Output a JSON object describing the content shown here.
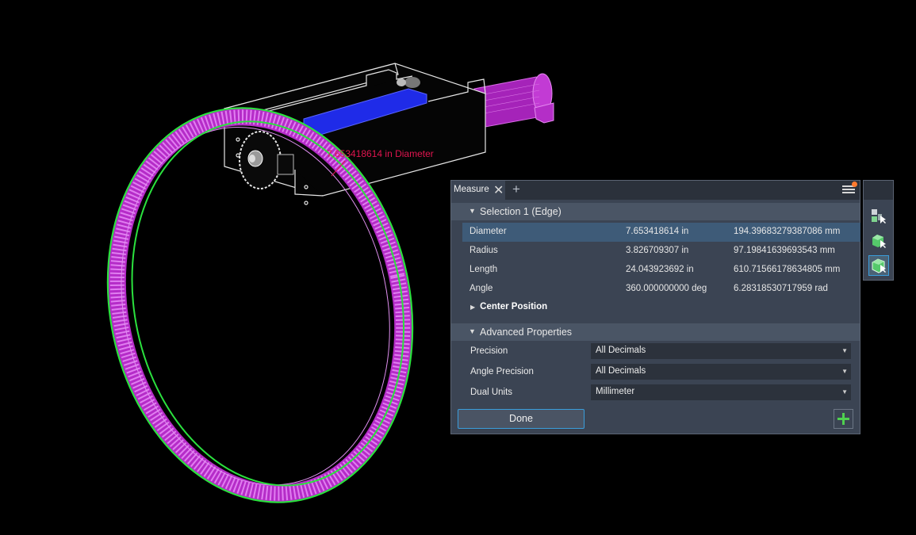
{
  "viewport": {
    "dimension_label": "7.653418614 in Diameter",
    "colors": {
      "ring": "#c94bd6",
      "ring_edge": "#28e03a",
      "slot": "#2233ee",
      "shaft": "#b026c4",
      "dimension": "#e0154f"
    }
  },
  "measure": {
    "tab_label": "Measure",
    "selection_header": "Selection 1 (Edge)",
    "rows": [
      {
        "label": "Diameter",
        "value_in": "7.653418614 in",
        "value_mm": "194.39683279387086 mm"
      },
      {
        "label": "Radius",
        "value_in": "3.826709307 in",
        "value_mm": "97.19841639693543 mm"
      },
      {
        "label": "Length",
        "value_in": "24.043923692 in",
        "value_mm": "610.71566178634805 mm"
      },
      {
        "label": "Angle",
        "value_in": "360.000000000 deg",
        "value_mm": "6.28318530717959 rad"
      }
    ],
    "center_position_label": "Center Position",
    "advanced_header": "Advanced Properties",
    "props": [
      {
        "label": "Precision",
        "value": "All Decimals"
      },
      {
        "label": "Angle Precision",
        "value": "All Decimals"
      },
      {
        "label": "Dual Units",
        "value": "Millimeter"
      }
    ],
    "done_label": "Done"
  },
  "accent_colors": {
    "highlight_row": "#3e5b78",
    "focus": "#3a9ddb",
    "add_plus": "#4fd04f",
    "menu_notify": "#ff7a2e"
  }
}
